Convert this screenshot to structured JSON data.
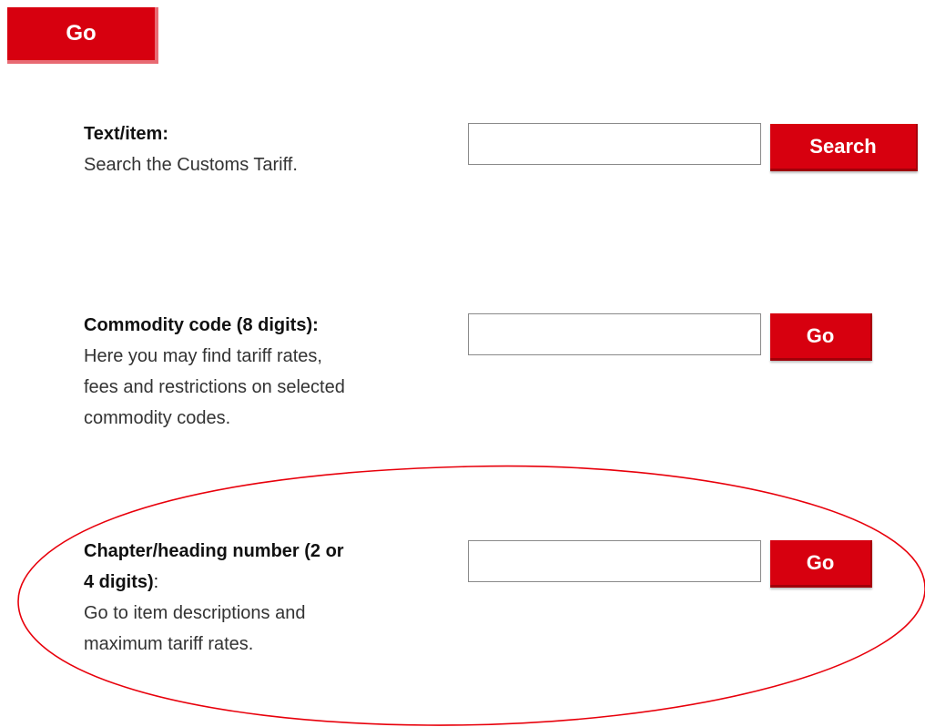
{
  "top": {
    "go_label": "Go"
  },
  "text_search": {
    "heading": "Text/item:",
    "description": "Search the Customs Tariff.",
    "input_value": "",
    "button_label": "Search"
  },
  "commodity": {
    "heading": "Commodity code (8 digits):",
    "description_lines": [
      "Here you may find tariff rates,",
      "fees and restrictions on selected",
      "commodity codes."
    ],
    "input_value": "",
    "button_label": "Go"
  },
  "chapter": {
    "heading_line1": "Chapter/heading number (2 or",
    "heading_line2": "4 digits)",
    "heading_colon": ":",
    "description_lines": [
      "Go to item descriptions and",
      "maximum tariff rates."
    ],
    "input_value": "",
    "button_label": "Go"
  },
  "colors": {
    "button_red": "#d7000f",
    "annotation_red": "#e8000b"
  }
}
